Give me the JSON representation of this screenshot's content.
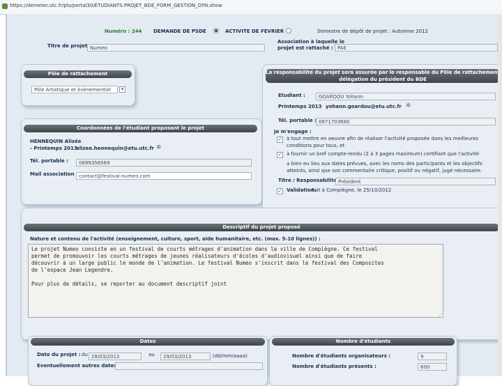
{
  "browser": {
    "url": "https://demeter.utc.fr/pls/portal30/ETUDIANTS.PROJET_BDE_FORM_GESTION_DYN.show"
  },
  "header": {
    "numero": "Numéro : 244",
    "option_bde": "DEMANDE DE PSDE",
    "option_fevrier": "ACTIVITE DE FEVRIER",
    "semestre": "Semestre de dépôt de projet : Automne 2012"
  },
  "projet": {
    "titre_label": "Titre de projet :",
    "titre_value": "Numeo",
    "association_label_1": "Association à laquelle le",
    "association_label_2": "projet est rattaché :",
    "association_value": "PAE"
  },
  "pole": {
    "header": "Pôle de rattachement",
    "value": "Pôle Artistique et évènementiel"
  },
  "responsable_panel": {
    "header_1": "La responsabilité du projet sera assurée par le responsable du Pôle de rattachement ou par",
    "header_2": "délégation du président du BDE",
    "etudiant_label": "Etudiant :",
    "etudiant_value": "GOARDOU Yohann",
    "etudiant_semestre": "Printemps 2013",
    "etudiant_email": "yohann.goardou@etu.utc.fr",
    "tel_label": "Tél. portable :",
    "tel_value": "0671703680",
    "engage_label": "Je m'engage :",
    "engagements": [
      "à tout mettre en oeuvre afin de réaliser l'activité proposée dans les meilleures",
      "conditions pour tous, et",
      "à fournir un bref compte-rendu (2 à 3 pages maximum) certifiant que l'activité",
      "a bien eu lieu aux dates prévues, avec les noms des participants et les objectifs",
      "atteints, ainsi que son commentaire critique, positif ou négatif, jugé nécessaire."
    ],
    "titre_resp_label": "Titre / Responsabilité :",
    "titre_resp_value": "Président",
    "validation_label": "Validation.",
    "validation_value": "Fait à Compiègne, le 25/10/2012"
  },
  "coordonnees": {
    "header": "Coordonnées de l'étudiant proposant le projet",
    "nom": "HENNEQUIN Alizée",
    "semestre": "- Printemps 2013",
    "email": "alizee.hennequin@etu.utc.fr",
    "tel_label": "Tél. portable :",
    "tel_value": "0699356569",
    "mail_assoc_label": "Mail association :",
    "mail_assoc_value": "contact@festival-numeo.com"
  },
  "descriptif": {
    "header": "Descriptif du projet proposé",
    "label": "Nature et contenu de l'activité (enseignement, culture, sport, aide humanitaire, etc. (max. 5-10 lignes)) :",
    "text": "Le projet Numeo consiste en un festival de courts métrages d'animation dans la ville de Compiègne. Ce festival\npermet de promouvoir les courts métrages de jeunes réalisateurs d'écoles d'audiovisuel ainsi que de faire\ndécouvrir à un large public le monde de l'animation. Le festival Numeo s'inscrit dans le festival des Composites\nde l'espace Jean Legendre.\n\nPour plus de détails, se reporter au document descriptif joint"
  },
  "dates": {
    "header": "Dates",
    "date_label": "Date du projet :",
    "du": "du",
    "au": "au",
    "from": "28/03/2013",
    "to": "29/03/2013",
    "format": "(dd/mm/aaaa)",
    "autres_label": "Eventuellement autres dates :"
  },
  "nombre": {
    "header": "Nombre d'étudiants",
    "organisateurs_label": "Nombre d'étudiants organisateurs :",
    "organisateurs_value": "9",
    "presents_label": "Nombre d'étudiants présents :",
    "presents_value": "600"
  },
  "colors": {
    "panel_header": "#4f565c",
    "page_bg": "#e3eaf2",
    "label_green": "#2e7d32"
  }
}
